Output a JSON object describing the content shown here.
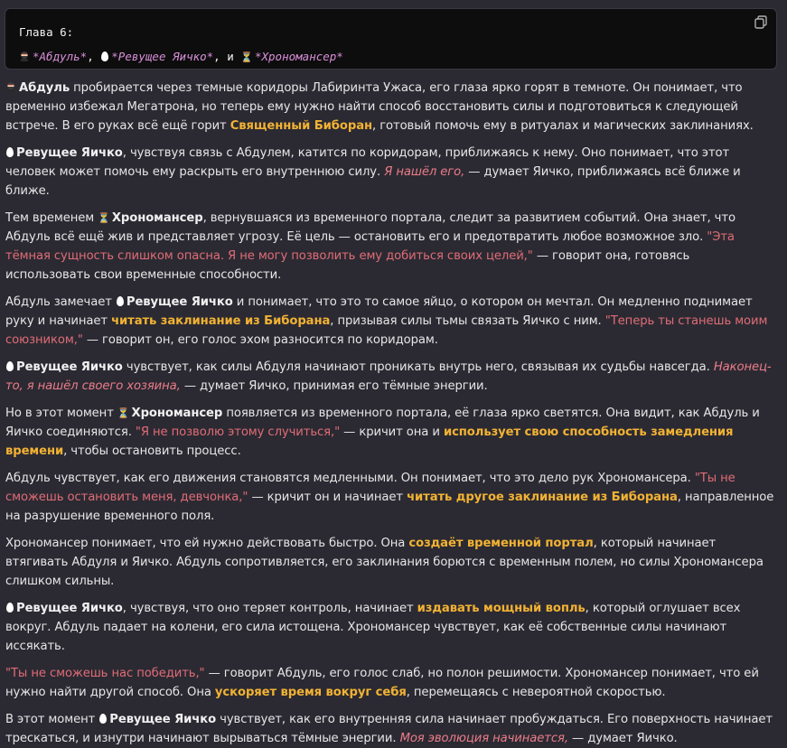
{
  "code_block": {
    "title": "Глава 6:",
    "chars": [
      "*Абдуль*",
      "*Ревущее Яичко*",
      "*Хрономансер*"
    ],
    "sep1": ", ",
    "sep2": ", и "
  },
  "icons": {
    "copy": "copy-icon",
    "abdul": "ninja-icon",
    "egg": "egg-icon",
    "hourglass": "hourglass-icon"
  },
  "colors": {
    "highlight": "#f2b233",
    "quote": "#e06c75",
    "code_char": "#d98fd9"
  },
  "paragraphs": [
    [
      {
        "t": "icon",
        "v": "ninja"
      },
      {
        "t": "b",
        "v": "Абдуль"
      },
      {
        "t": "n",
        "v": " пробирается через темные коридоры Лабиринта Ужаса, его глаза ярко горят в темноте. Он понимает, что временно избежал Мегатрона, но теперь ему нужно найти способ восстановить силы и подготовиться к следующей встрече. В его руках всё ещё горит "
      },
      {
        "t": "hl",
        "v": "Священный Биборан"
      },
      {
        "t": "n",
        "v": ", готовый помочь ему в ритуалах и магических заклинаниях."
      }
    ],
    [
      {
        "t": "icon",
        "v": "egg"
      },
      {
        "t": "b",
        "v": "Ревущее Яичко"
      },
      {
        "t": "n",
        "v": ", чувствуя связь с Абдулем, катится по коридорам, приближаясь к нему. Оно понимает, что этот человек может помочь ему раскрыть его внутреннюю силу. "
      },
      {
        "t": "iq",
        "v": "Я нашёл его,"
      },
      {
        "t": "n",
        "v": " — думает Яичко, приближаясь всё ближе и ближе."
      }
    ],
    [
      {
        "t": "n",
        "v": "Тем временем "
      },
      {
        "t": "icon",
        "v": "hourglass"
      },
      {
        "t": "b",
        "v": "Хрономансер"
      },
      {
        "t": "n",
        "v": ", вернувшаяся из временного портала, следит за развитием событий. Она знает, что Абдуль всё ещё жив и представляет угрозу. Её цель — остановить его и предотвратить любое возможное зло. "
      },
      {
        "t": "q",
        "v": "\"Эта тёмная сущность слишком опасна. Я не могу позволить ему добиться своих целей,\""
      },
      {
        "t": "n",
        "v": " — говорит она, готовясь использовать свои временные способности."
      }
    ],
    [
      {
        "t": "n",
        "v": "Абдуль замечает "
      },
      {
        "t": "icon",
        "v": "egg"
      },
      {
        "t": "b",
        "v": "Ревущее Яичко"
      },
      {
        "t": "n",
        "v": " и понимает, что это то самое яйцо, о котором он мечтал. Он медленно поднимает руку и начинает "
      },
      {
        "t": "hl",
        "v": "читать заклинание из Биборана"
      },
      {
        "t": "n",
        "v": ", призывая силы тьмы связать Яичко с ним. "
      },
      {
        "t": "q",
        "v": "\"Теперь ты станешь моим союзником,\""
      },
      {
        "t": "n",
        "v": " — говорит он, его голос эхом разносится по коридорам."
      }
    ],
    [
      {
        "t": "icon",
        "v": "egg"
      },
      {
        "t": "b",
        "v": "Ревущее Яичко"
      },
      {
        "t": "n",
        "v": " чувствует, как силы Абдуля начинают проникать внутрь него, связывая их судьбы навсегда. "
      },
      {
        "t": "iq",
        "v": "Наконец-то, я нашёл своего хозяина,"
      },
      {
        "t": "n",
        "v": " — думает Яичко, принимая его тёмные энергии."
      }
    ],
    [
      {
        "t": "n",
        "v": "Но в этот момент "
      },
      {
        "t": "icon",
        "v": "hourglass"
      },
      {
        "t": "b",
        "v": "Хрономансер"
      },
      {
        "t": "n",
        "v": " появляется из временного портала, её глаза ярко светятся. Она видит, как Абдуль и Яичко соединяются. "
      },
      {
        "t": "q",
        "v": "\"Я не позволю этому случиться,\""
      },
      {
        "t": "n",
        "v": " — кричит она и "
      },
      {
        "t": "hl",
        "v": "использует свою способность замедления времени"
      },
      {
        "t": "n",
        "v": ", чтобы остановить процесс."
      }
    ],
    [
      {
        "t": "n",
        "v": "Абдуль чувствует, как его движения становятся медленными. Он понимает, что это дело рук Хрономансера. "
      },
      {
        "t": "q",
        "v": "\"Ты не сможешь остановить меня, девчонка,\""
      },
      {
        "t": "n",
        "v": " — кричит он и начинает "
      },
      {
        "t": "hl",
        "v": "читать другое заклинание из Биборана"
      },
      {
        "t": "n",
        "v": ", направленное на разрушение временного поля."
      }
    ],
    [
      {
        "t": "n",
        "v": "Хрономансер понимает, что ей нужно действовать быстро. Она "
      },
      {
        "t": "hl",
        "v": "создаёт временной портал"
      },
      {
        "t": "n",
        "v": ", который начинает втягивать Абдуля и Яичко. Абдуль сопротивляется, его заклинания борются с временным полем, но силы Хрономансера слишком сильны."
      }
    ],
    [
      {
        "t": "icon",
        "v": "egg"
      },
      {
        "t": "b",
        "v": "Ревущее Яичко"
      },
      {
        "t": "n",
        "v": ", чувствуя, что оно теряет контроль, начинает "
      },
      {
        "t": "hl",
        "v": "издавать мощный вопль"
      },
      {
        "t": "n",
        "v": ", который оглушает всех вокруг. Абдуль падает на колени, его сила истощена. Хрономансер чувствует, как её собственные силы начинают иссякать."
      }
    ],
    [
      {
        "t": "q",
        "v": "\"Ты не сможешь нас победить,\""
      },
      {
        "t": "n",
        "v": " — говорит Абдуль, его голос слаб, но полон решимости. Хрономансер понимает, что ей нужно найти другой способ. Она "
      },
      {
        "t": "hl",
        "v": "ускоряет время вокруг себя"
      },
      {
        "t": "n",
        "v": ", перемещаясь с невероятной скоростью."
      }
    ],
    [
      {
        "t": "n",
        "v": "В этот момент "
      },
      {
        "t": "icon",
        "v": "egg"
      },
      {
        "t": "b",
        "v": "Ревущее Яичко"
      },
      {
        "t": "n",
        "v": " чувствует, как его внутренняя сила начинает пробуждаться. Его поверхность начинает трескаться, и изнутри начинают вырываться тёмные энергии. "
      },
      {
        "t": "iq",
        "v": "Моя эволюция начинается,"
      },
      {
        "t": "n",
        "v": " — думает Яичко."
      }
    ]
  ]
}
